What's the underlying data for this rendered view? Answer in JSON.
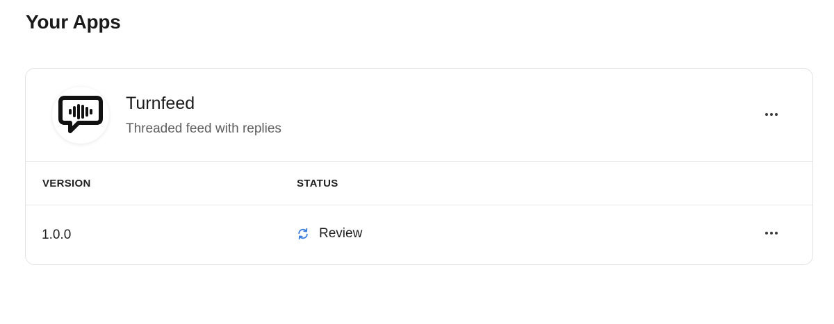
{
  "page": {
    "title": "Your Apps"
  },
  "app": {
    "name": "Turnfeed",
    "description": "Threaded feed with replies",
    "icon": "chat-bubble-waveform-icon",
    "menu_icon": "more-horizontal-icon"
  },
  "versions_table": {
    "columns": [
      "VERSION",
      "STATUS"
    ],
    "rows": [
      {
        "version": "1.0.0",
        "status": "Review",
        "status_icon": "refresh-icon",
        "status_color": "#3b7ddd"
      }
    ]
  }
}
